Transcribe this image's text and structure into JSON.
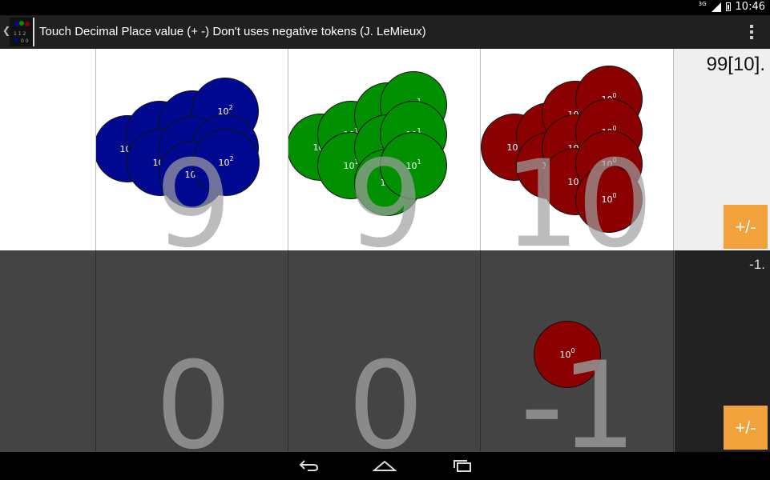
{
  "status_bar": {
    "network": "3G",
    "time": "10:46"
  },
  "action_bar": {
    "title": "Touch Decimal Place value (+ -) Don't uses negative tokens (J. LeMieux)",
    "logo_icon": "place-value-logo-icon",
    "overflow_icon": "overflow-menu-icon"
  },
  "colors": {
    "hundreds_token": "#00098f",
    "tens_token": "#009000",
    "ones_token": "#8b0000",
    "accent_button": "#f2a23a"
  },
  "top_row": {
    "columns": [
      {
        "digit": ""
      },
      {
        "digit": "9",
        "token_label": "10",
        "token_exp": "2"
      },
      {
        "digit": "9",
        "token_label": "10",
        "token_exp": "1"
      },
      {
        "digit": "10",
        "token_label": "10",
        "token_exp": "0"
      }
    ],
    "value": "99[10].",
    "toggle_label": "+/-"
  },
  "bottom_row": {
    "columns": [
      {
        "digit": ""
      },
      {
        "digit": "0"
      },
      {
        "digit": "0"
      },
      {
        "digit": "-1",
        "token_label": "10",
        "token_exp": "0"
      }
    ],
    "value": "-1.",
    "toggle_label": "+/-"
  }
}
